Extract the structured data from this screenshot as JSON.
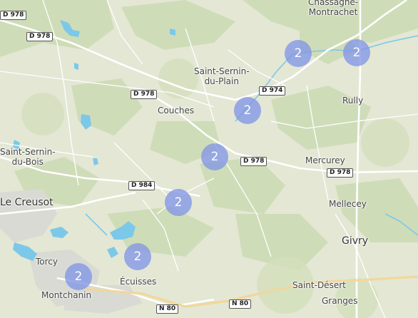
{
  "map": {
    "places": {
      "chassagne_line1": "Chassagne-",
      "chassagne_line2": "Montrachet",
      "saint_sernin_plain_line1": "Saint-Sernin-",
      "saint_sernin_plain_line2": "du-Plain",
      "couches": "Couches",
      "rully": "Rully",
      "saint_sernin_bois_line1": "Saint-Sernin-",
      "saint_sernin_bois_line2": "du-Bois",
      "mercurey": "Mercurey",
      "le_creusot": "Le Creusot",
      "mellecey": "Mellecey",
      "givry": "Givry",
      "torcy": "Torcy",
      "ecuisses": "Écuisses",
      "montchanin": "Montchanin",
      "saint_desert": "Saint-Désert",
      "granges": "Granges"
    },
    "roads": {
      "d978_a": "D 978",
      "d978_b": "D 978",
      "d978_c": "D 978",
      "d974": "D 974",
      "d978_d": "D 978",
      "d978_e": "D 978",
      "d984": "D 984",
      "n80_a": "N 80",
      "n80_b": "N 80"
    },
    "clusters": [
      {
        "count": "2"
      },
      {
        "count": "2"
      },
      {
        "count": "2"
      },
      {
        "count": "2"
      },
      {
        "count": "2"
      },
      {
        "count": "2"
      },
      {
        "count": "2"
      }
    ],
    "colors": {
      "land": "#e3e7d4",
      "forest": "#cfdcb8",
      "water": "#7cc8e8",
      "urban": "#d9dbd6",
      "cluster": "#8296e6"
    }
  }
}
